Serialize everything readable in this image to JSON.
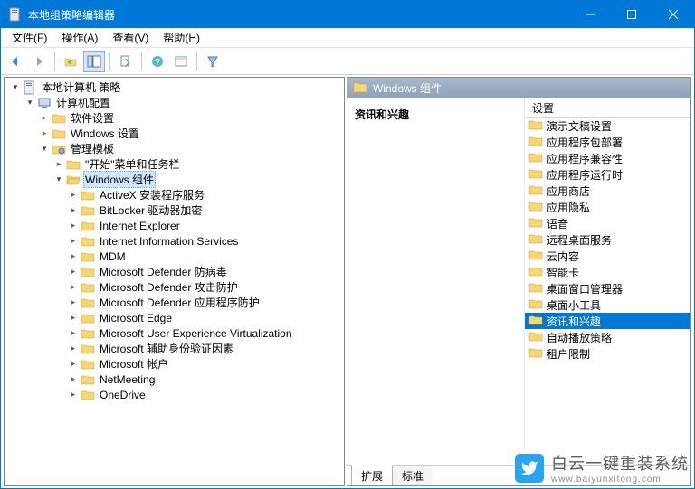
{
  "window": {
    "title": "本地组策略编辑器"
  },
  "menu": {
    "file": "文件(F)",
    "action": "操作(A)",
    "view": "查看(V)",
    "help": "帮助(H)"
  },
  "tree": {
    "root": "本地计算机 策略",
    "computer_config": "计算机配置",
    "software_settings": "软件设置",
    "windows_settings": "Windows 设置",
    "admin_templates": "管理模板",
    "start_menu_taskbar": "\"开始\"菜单和任务栏",
    "windows_components": "Windows 组件",
    "items": [
      "ActiveX 安装程序服务",
      "BitLocker 驱动器加密",
      "Internet Explorer",
      "Internet Information Services",
      "MDM",
      "Microsoft Defender 防病毒",
      "Microsoft Defender 攻击防护",
      "Microsoft Defender 应用程序防护",
      "Microsoft Edge",
      "Microsoft User Experience Virtualization",
      "Microsoft 辅助身份验证因素",
      "Microsoft 帐户",
      "NetMeeting",
      "OneDrive"
    ]
  },
  "right": {
    "header": "Windows 组件",
    "desc_title": "资讯和兴趣",
    "col_header": "设置",
    "items": [
      "演示文稿设置",
      "应用程序包部署",
      "应用程序兼容性",
      "应用程序运行时",
      "应用商店",
      "应用隐私",
      "语音",
      "远程桌面服务",
      "云内容",
      "智能卡",
      "桌面窗口管理器",
      "桌面小工具",
      "资讯和兴趣",
      "自动播放策略",
      "租户限制"
    ],
    "selected_index": 12,
    "tabs": {
      "extended": "扩展",
      "standard": "标准"
    }
  },
  "watermark": {
    "cn": "白云一键重装系统",
    "en": "www.baiyunxitong.com"
  }
}
